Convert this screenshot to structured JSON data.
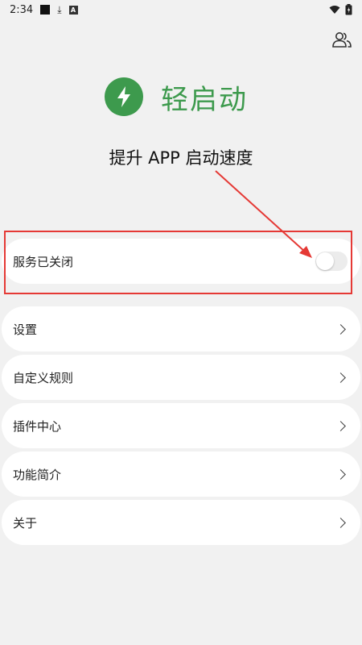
{
  "status_bar": {
    "time": "2:34",
    "icons": [
      "black-square-notification",
      "download-icon",
      "a-icon",
      "wifi-icon",
      "battery-icon"
    ]
  },
  "header": {
    "user_icon": "users-icon"
  },
  "brand": {
    "logo_icon": "lightning-bolt-icon",
    "name": "轻启动",
    "color": "#3d9a4d"
  },
  "slogan": "提升 APP 启动速度",
  "service": {
    "label": "服务已关闭",
    "enabled": false
  },
  "menu": [
    {
      "label": "设置"
    },
    {
      "label": "自定义规则"
    },
    {
      "label": "插件中心"
    },
    {
      "label": "功能简介"
    },
    {
      "label": "关于"
    }
  ],
  "annotation": {
    "color": "#e53935"
  }
}
